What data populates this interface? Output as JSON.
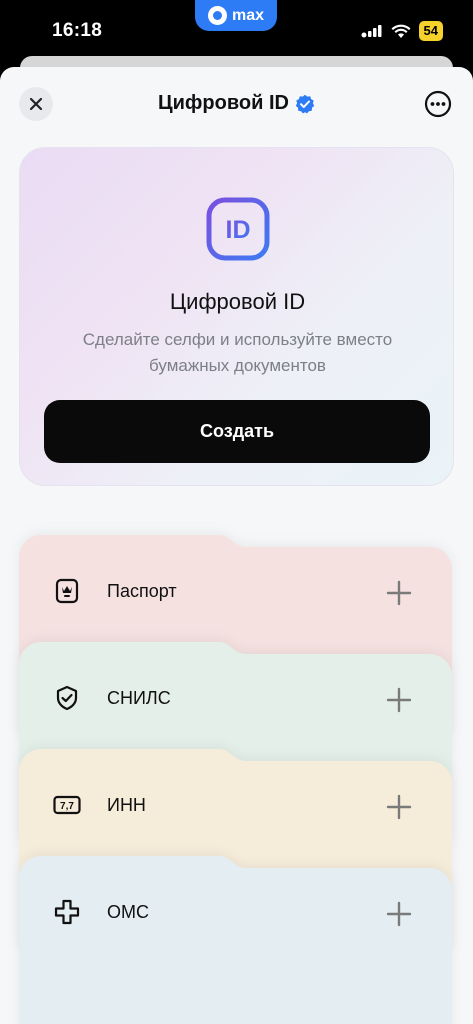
{
  "status_bar": {
    "time": "16:18",
    "island_app": "max",
    "battery": "54",
    "icons": [
      "signal-icon",
      "wifi-icon",
      "battery-icon"
    ]
  },
  "header": {
    "title": "Цифровой ID",
    "close_icon": "close-icon",
    "verified_icon": "verified-badge-icon",
    "more_icon": "more-icon"
  },
  "hero": {
    "icon_text": "ID",
    "title": "Цифровой ID",
    "subtitle": "Сделайте селфи и используйте вместо бумажных документов",
    "button_label": "Создать"
  },
  "documents": [
    {
      "label": "Паспорт",
      "icon": "passport-icon",
      "color": "#f4e1e0"
    },
    {
      "label": "СНИЛС",
      "icon": "shield-check-icon",
      "color": "#e4efe9"
    },
    {
      "label": "ИНН",
      "icon": "inn-icon",
      "icon_text": "7,7",
      "color": "#f6ecda"
    },
    {
      "label": "ОМС",
      "icon": "medical-cross-icon",
      "color": "#e3edf2"
    }
  ],
  "colors": {
    "accent": "#2d7cf6",
    "button_bg": "#0a0a0a",
    "battery": "#f5d12c"
  }
}
